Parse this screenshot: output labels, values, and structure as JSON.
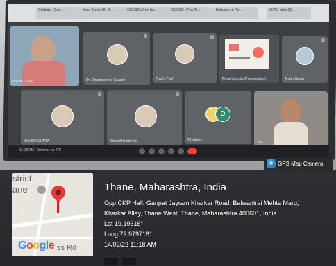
{
  "browser": {
    "tabs": [
      "Colibrity - Goo...",
      "Meet: Gene UI - A...",
      "SGGSD ePen-Sa...",
      "SGDSD ePen-Ai...",
      "Bohusma & Pe...",
      "MKTU Note (3)..."
    ]
  },
  "meet": {
    "participants": [
      {
        "name": "Piyush Landu",
        "type": "video"
      },
      {
        "name": "Dr. Dharmeshree Sawant",
        "type": "avatar"
      },
      {
        "name": "Prachi Patil",
        "type": "avatar"
      },
      {
        "name": "Piyush Landu (Presentation)",
        "type": "presentation"
      },
      {
        "name": "Aman Gupta",
        "type": "avatar"
      },
      {
        "name": "KHUSHI GUPTA",
        "type": "avatar"
      },
      {
        "name": "Nisha Mahadevia",
        "type": "avatar"
      },
      {
        "name": "22 others",
        "type": "others"
      },
      {
        "name": "You",
        "type": "video"
      }
    ],
    "footer_left": "11:18 AM  |  Webinar on IPR",
    "others_initial": "D"
  },
  "overlay": {
    "badge": "GPS Map Camera",
    "place": "Thane, Maharashtra, India",
    "address_line1": "Opp.CKP Hall, Ganpat Jayram Kharkar Road, Balwantrai Mehta Marg,",
    "address_line2": "Kharkar Alley, Thane West, Thane, Maharashtra 400601, India",
    "lat": "Lat 19.19616°",
    "long": "Long 72.979718°",
    "datetime": "14/02/22 11:18 AM",
    "map": {
      "label_district": "strict",
      "label_city": "ane",
      "logo": "Google",
      "road": "ss Rd"
    }
  },
  "colors": {
    "pin": "#e53935",
    "meet_bg": "#3c4043",
    "end_call": "#ea4335"
  }
}
